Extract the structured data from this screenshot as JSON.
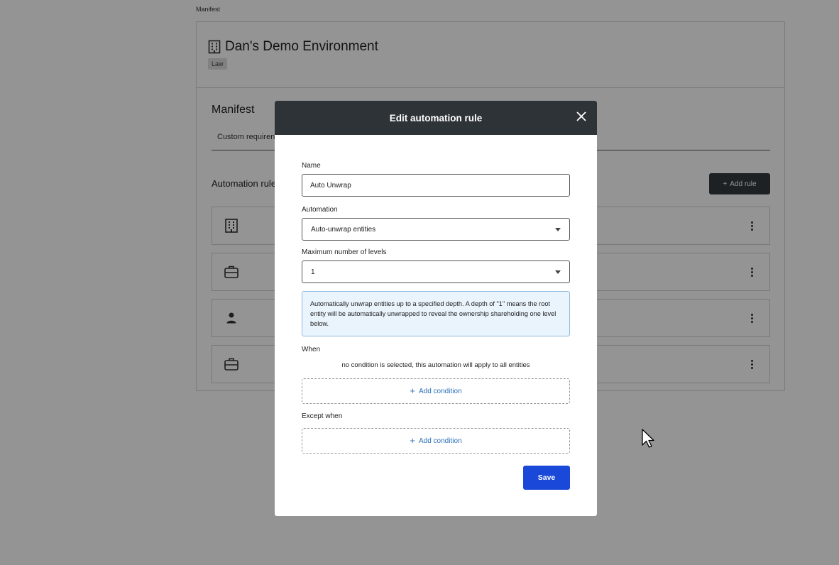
{
  "breadcrumb": "Manifest",
  "environment": {
    "icon": "building-icon",
    "title": "Dan's Demo Environment",
    "tag": "Law"
  },
  "manifest": {
    "title": "Manifest",
    "tab": "Custom requiren"
  },
  "automation_rules": {
    "title": "Automation rule",
    "add_button": "Add rule",
    "rows": [
      {
        "icon": "building-icon"
      },
      {
        "icon": "briefcase-icon"
      },
      {
        "icon": "person-icon"
      },
      {
        "icon": "briefcase-icon"
      }
    ]
  },
  "modal": {
    "title": "Edit automation rule",
    "name_label": "Name",
    "name_value": "Auto Unwrap",
    "automation_label": "Automation",
    "automation_value": "Auto-unwrap entities",
    "levels_label": "Maximum number of levels",
    "levels_value": "1",
    "info_text": "Automatically unwrap entities up to a specified depth. A depth of \"1\" means the root entity will be automatically unwrapped to reveal the ownership shareholding one level below.",
    "when_label": "When",
    "when_hint": "no condition is selected, this automation will apply to all entities",
    "add_condition": "Add condition",
    "except_label": "Except when",
    "except_add_condition": "Add condition",
    "save": "Save"
  },
  "colors": {
    "modal_header": "#2e3338",
    "primary": "#1a48d8",
    "link": "#2a6fb8",
    "info_bg": "#eaf4fd"
  }
}
